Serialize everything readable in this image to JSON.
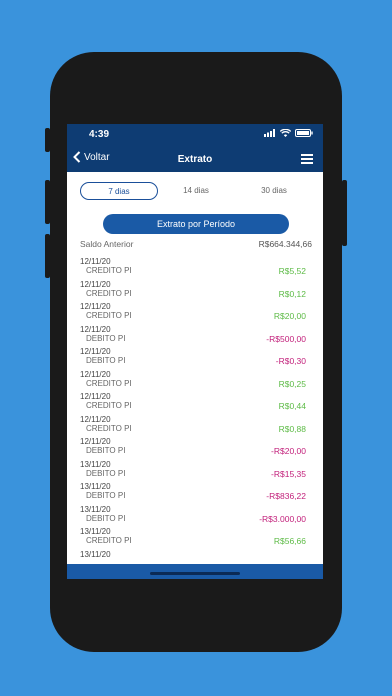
{
  "status": {
    "time": "4:39"
  },
  "nav": {
    "back_label": "Voltar",
    "title": "Extrato"
  },
  "tabs": [
    {
      "label": "7 dias",
      "active": true
    },
    {
      "label": "14 dias",
      "active": false
    },
    {
      "label": "30 dias",
      "active": false
    }
  ],
  "periodo_button": "Extrato por Período",
  "saldo": {
    "label": "Saldo Anterior",
    "value": "R$664.344,66"
  },
  "transactions": [
    {
      "date": "12/11/20",
      "desc": "CREDITO PI",
      "amount": "R$5,52",
      "type": "credit"
    },
    {
      "date": "12/11/20",
      "desc": "CREDITO PI",
      "amount": "R$0,12",
      "type": "credit"
    },
    {
      "date": "12/11/20",
      "desc": "CREDITO PI",
      "amount": "R$20,00",
      "type": "credit"
    },
    {
      "date": "12/11/20",
      "desc": "DEBITO PI",
      "amount": "-R$500,00",
      "type": "debit"
    },
    {
      "date": "12/11/20",
      "desc": "DEBITO PI",
      "amount": "-R$0,30",
      "type": "debit"
    },
    {
      "date": "12/11/20",
      "desc": "CREDITO PI",
      "amount": "R$0,25",
      "type": "credit"
    },
    {
      "date": "12/11/20",
      "desc": "CREDITO PI",
      "amount": "R$0,44",
      "type": "credit"
    },
    {
      "date": "12/11/20",
      "desc": "CREDITO PI",
      "amount": "R$0,88",
      "type": "credit"
    },
    {
      "date": "12/11/20",
      "desc": "DEBITO PI",
      "amount": "-R$20,00",
      "type": "debit"
    },
    {
      "date": "13/11/20",
      "desc": "DEBITO PI",
      "amount": "-R$15,35",
      "type": "debit"
    },
    {
      "date": "13/11/20",
      "desc": "DEBITO PI",
      "amount": "-R$836,22",
      "type": "debit"
    },
    {
      "date": "13/11/20",
      "desc": "DEBITO PI",
      "amount": "-R$3.000,00",
      "type": "debit"
    },
    {
      "date": "13/11/20",
      "desc": "CREDITO PI",
      "amount": "R$56,66",
      "type": "credit"
    }
  ],
  "last_date": "13/11/20",
  "colors": {
    "background": "#3a93dc",
    "navbar": "#0e3c73",
    "accent": "#1a5aa6",
    "credit": "#5dbb46",
    "debit": "#c21f7a"
  }
}
